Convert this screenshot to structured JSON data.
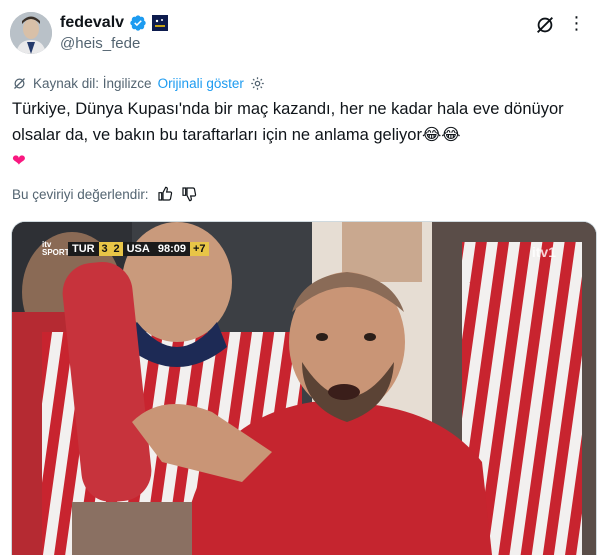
{
  "author": {
    "display_name": "fedevalv",
    "handle": "@heis_fede"
  },
  "translation": {
    "source_label": "Kaynak dil: İngilizce",
    "show_original": "Orijinali göster"
  },
  "tweet": {
    "text": "Türkiye, Dünya Kupası'nda bir maç kazandı, her ne kadar hala eve dönüyor olsalar da, ve bakın bu taraftarları için ne anlama geliyor😂😂",
    "heart": "❤"
  },
  "rating": {
    "label": "Bu çeviriyi değerlendir:"
  },
  "media": {
    "scorebug": {
      "channel": "itv SPORT",
      "team_home": "TUR",
      "score_home": "3",
      "score_away": "2",
      "team_away": "USA",
      "clock": "98:09",
      "added_time": "+7"
    },
    "watermark": "itv1"
  },
  "colors": {
    "accent": "#1d9bf0",
    "secondary_text": "#536471",
    "heart": "#f91880"
  }
}
